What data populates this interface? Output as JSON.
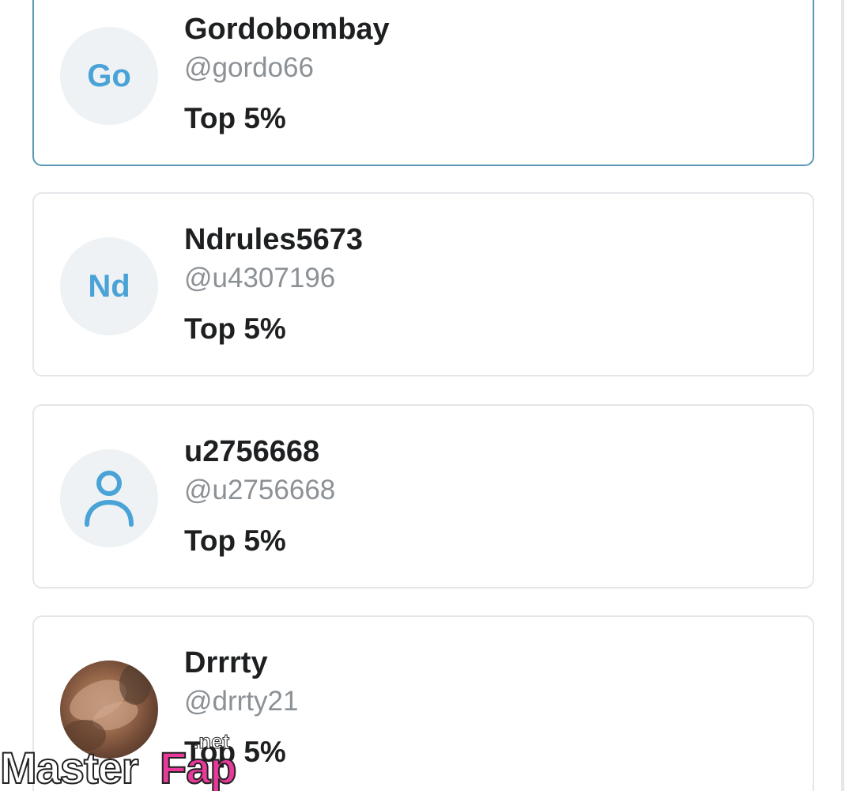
{
  "users": [
    {
      "name": "Gordobombay",
      "handle": "@gordo66",
      "rank": "Top 5%",
      "avatar_initials": "Go",
      "avatar_type": "initials",
      "active": true
    },
    {
      "name": "Ndrules5673",
      "handle": "@u4307196",
      "rank": "Top 5%",
      "avatar_initials": "Nd",
      "avatar_type": "initials",
      "active": false
    },
    {
      "name": "u2756668",
      "handle": "@u2756668",
      "rank": "Top 5%",
      "avatar_icon": "person-icon",
      "avatar_type": "icon",
      "active": false
    },
    {
      "name": "Drrrty",
      "handle": "@drrty21",
      "rank": "Top 5%",
      "avatar_type": "photo",
      "active": false
    }
  ],
  "watermark": {
    "part1": "Master",
    "part2": "Fap",
    "part3": ".net"
  },
  "colors": {
    "accent": "#4aa3d6",
    "active_border": "#5b98b8",
    "card_border": "#e4e7ea",
    "avatar_bg": "#eef2f4",
    "text_primary": "#1d1f21",
    "text_secondary": "#8c9196",
    "watermark_pink": "#e83a9a"
  }
}
